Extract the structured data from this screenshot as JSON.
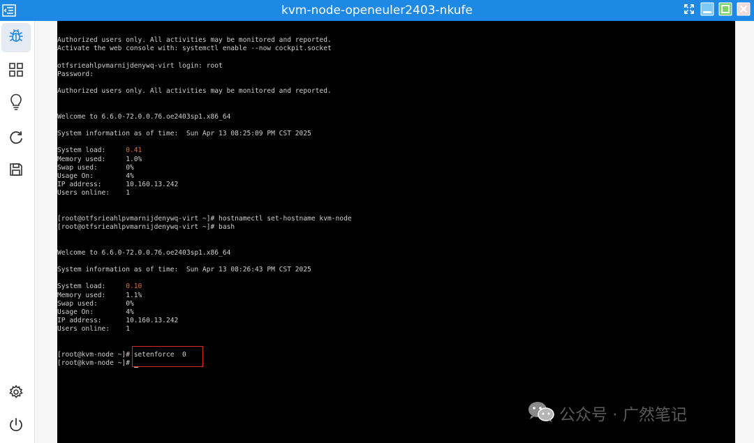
{
  "window": {
    "title": "kvm-node-openeuler2403-nkufe"
  },
  "colors": {
    "titlebar": "#1e88e5",
    "highlight_value": "#e06c2f",
    "annotation_box": "#d8262d"
  },
  "sidebar": {
    "items": [
      {
        "icon": "bug-icon",
        "active": true
      },
      {
        "icon": "grid-icon"
      },
      {
        "icon": "lightbulb-icon"
      },
      {
        "icon": "refresh-icon"
      },
      {
        "icon": "save-icon"
      }
    ],
    "bottom": [
      {
        "icon": "gear-icon"
      },
      {
        "icon": "power-icon"
      }
    ]
  },
  "terminal": {
    "lines": [
      {
        "text": "Authorized users only. All activities may be monitored and reported."
      },
      {
        "text": "Activate the web console with: systemctl enable --now cockpit.socket"
      },
      {
        "text": ""
      },
      {
        "text": "otfsrieahlpvmarnijdenywq-virt login: root"
      },
      {
        "text": "Password:"
      },
      {
        "text": ""
      },
      {
        "text": "Authorized users only. All activities may be monitored and reported."
      },
      {
        "text": ""
      },
      {
        "text": ""
      },
      {
        "text": "Welcome to 6.6.0-72.0.0.76.oe2403sp1.x86_64"
      },
      {
        "text": ""
      },
      {
        "text": "System information as of time:  Sun Apr 13 08:25:09 PM CST 2025"
      },
      {
        "text": ""
      },
      {
        "text": "System load:     ",
        "value": "0.41"
      },
      {
        "text": "Memory used:     1.0%"
      },
      {
        "text": "Swap used:       0%"
      },
      {
        "text": "Usage On:        4%"
      },
      {
        "text": "IP address:      10.160.13.242"
      },
      {
        "text": "Users online:    1"
      },
      {
        "text": ""
      },
      {
        "text": ""
      },
      {
        "text": "[root@otfsrieahlpvmarnijdenywq-virt ~]# hostnamectl set-hostname kvm-node"
      },
      {
        "text": "[root@otfsrieahlpvmarnijdenywq-virt ~]# bash"
      },
      {
        "text": ""
      },
      {
        "text": ""
      },
      {
        "text": "Welcome to 6.6.0-72.0.0.76.oe2403sp1.x86_64"
      },
      {
        "text": ""
      },
      {
        "text": "System information as of time:  Sun Apr 13 08:26:43 PM CST 2025"
      },
      {
        "text": ""
      },
      {
        "text": "System load:     ",
        "value": "0.10"
      },
      {
        "text": "Memory used:     1.1%"
      },
      {
        "text": "Swap used:       0%"
      },
      {
        "text": "Usage On:        4%"
      },
      {
        "text": "IP address:      10.160.13.242"
      },
      {
        "text": "Users online:    1"
      },
      {
        "text": ""
      },
      {
        "text": ""
      },
      {
        "text": "[root@kvm-node ~]# setenforce  0"
      },
      {
        "text": "[root@kvm-node ~]# ",
        "cursor": true
      }
    ]
  },
  "watermark": {
    "text": "公众号 · 广然笔记"
  }
}
